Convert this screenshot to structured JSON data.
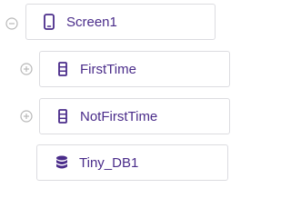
{
  "tree": {
    "screen1": {
      "label": "Screen1",
      "icon": "phone-icon",
      "toggle": "collapse"
    },
    "firsttime": {
      "label": "FirstTime",
      "icon": "vertical-arrangement-icon",
      "toggle": "expand"
    },
    "notfirsttime": {
      "label": "NotFirstTime",
      "icon": "vertical-arrangement-icon",
      "toggle": "expand"
    },
    "tinydb": {
      "label": "Tiny_DB1",
      "icon": "database-icon"
    }
  },
  "colors": {
    "accent": "#4a2c8a",
    "toggle": "#b8b8b8",
    "border": "#dcdce0"
  }
}
